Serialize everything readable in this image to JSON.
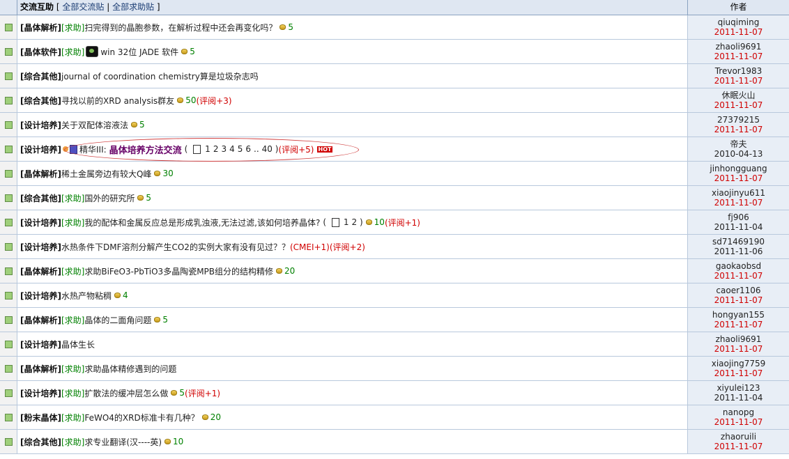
{
  "header": {
    "title": "交流互助",
    "bracket_open": "[",
    "link_all_exchange": "全部交流贴",
    "sep": "|",
    "link_all_help": "全部求助贴",
    "bracket_close": "]",
    "author_col": "作者"
  },
  "rows": [
    {
      "cat": "[晶体解析]",
      "help": "[求助]",
      "title": "扫完得到的晶胞参数，在解析过程中还会再变化吗？",
      "score": "5",
      "review": "",
      "author": "qiuqiming",
      "date": "2011-11-07",
      "date_color": "red"
    },
    {
      "cat": "[晶体软件]",
      "help": "[求助]",
      "title": "win 32位 JADE 软件",
      "score": "5",
      "review": "",
      "author": "zhaoli9691",
      "date": "2011-11-07",
      "date_color": "red"
    },
    {
      "cat": "[综合其他]",
      "help": "",
      "title": "journal of coordination chemistry算是垃圾杂志吗",
      "score": "",
      "review": "",
      "author": "Trevor1983",
      "date": "2011-11-07",
      "date_color": "red"
    },
    {
      "cat": "[综合其他]",
      "help": "",
      "title": "寻找以前的XRD analysis群友",
      "score": "50",
      "review": "(评阅+3)",
      "author": "休眠火山",
      "date": "2011-11-07",
      "date_color": "red"
    },
    {
      "cat": "[设计培养]",
      "help": "",
      "title": "关于双配体溶液法",
      "score": "5",
      "review": "",
      "author": "27379215",
      "date": "2011-11-07",
      "date_color": "red"
    },
    {
      "cat": "[设计培养]",
      "help": "",
      "title": "晶体培养方法交流",
      "score": "",
      "review": "(评阅+5)",
      "author": "帝夫",
      "date": "2010-04-13",
      "date_color": "black",
      "featured": true,
      "essence_label": "精华III:",
      "pages": [
        "1",
        "2",
        "3",
        "4",
        "5",
        "6",
        "..",
        "40"
      ],
      "hot": "HOT"
    },
    {
      "cat": "[晶体解析]",
      "help": "",
      "title": "稀土金属旁边有较大Q峰",
      "score": "30",
      "review": "",
      "author": "jinhongguang",
      "date": "2011-11-07",
      "date_color": "red"
    },
    {
      "cat": "[综合其他]",
      "help": "[求助]",
      "title": "国外的研究所",
      "score": "5",
      "review": "",
      "author": "xiaojinyu611",
      "date": "2011-11-07",
      "date_color": "red"
    },
    {
      "cat": "[设计培养]",
      "help": "[求助]",
      "title": "我的配体和金属反应总是形成乳浊液,无法过滤,该如何培养晶体?",
      "score": "10",
      "review": "(评阅+1)",
      "author": "fj906",
      "date": "2011-11-04",
      "date_color": "black",
      "pages": [
        "1",
        "2"
      ]
    },
    {
      "cat": "[设计培养]",
      "help": "",
      "title": "水热条件下DMF溶剂分解产生CO2的实例大家有没有见过？？",
      "score": "",
      "review": "(CMEI+1)(评阅+2)",
      "author": "sd71469190",
      "date": "2011-11-06",
      "date_color": "black"
    },
    {
      "cat": "[晶体解析]",
      "help": "[求助]",
      "title": "求助BiFeO3-PbTiO3多晶陶瓷MPB组分的结构精修",
      "score": "20",
      "review": "",
      "author": "gaokaobsd",
      "date": "2011-11-07",
      "date_color": "red"
    },
    {
      "cat": "[设计培养]",
      "help": "",
      "title": "水热产物粘稠",
      "score": "4",
      "review": "",
      "author": "caoer1106",
      "date": "2011-11-07",
      "date_color": "red"
    },
    {
      "cat": "[晶体解析]",
      "help": "[求助]",
      "title": "晶体的二面角问题",
      "score": "5",
      "review": "",
      "author": "hongyan155",
      "date": "2011-11-07",
      "date_color": "red"
    },
    {
      "cat": "[设计培养]",
      "help": "",
      "title": "晶体生长",
      "score": "",
      "review": "",
      "author": "zhaoli9691",
      "date": "2011-11-07",
      "date_color": "red"
    },
    {
      "cat": "[晶体解析]",
      "help": "[求助]",
      "title": "求助晶体精修遇到的问题",
      "score": "",
      "review": "",
      "author": "xiaojing7759",
      "date": "2011-11-07",
      "date_color": "red"
    },
    {
      "cat": "[设计培养]",
      "help": "[求助]",
      "title": "扩散法的缓冲层怎么做",
      "score": "5",
      "review": "(评阅+1)",
      "author": "xiyulei123",
      "date": "2011-11-04",
      "date_color": "black"
    },
    {
      "cat": "[粉末晶体]",
      "help": "[求助]",
      "title": "FeWO4的XRD标准卡有几种？",
      "score": "20",
      "review": "",
      "author": "nanopg",
      "date": "2011-11-07",
      "date_color": "red"
    },
    {
      "cat": "[综合其他]",
      "help": "[求助]",
      "title": "求专业翻译(汉----英)",
      "score": "10",
      "review": "",
      "author": "zhaoruili",
      "date": "2011-11-07",
      "date_color": "red"
    }
  ],
  "colors": {
    "help_green": "#008000",
    "date_red": "#d00000",
    "essence_purple": "#660066",
    "oval_red": "#d04040"
  },
  "icons": {
    "status": "green-square-icon",
    "coin": "coin-icon",
    "page": "page-icon",
    "hot": "hot-badge-icon",
    "essence": "essence-doc-icon",
    "software": "eye-icon"
  }
}
